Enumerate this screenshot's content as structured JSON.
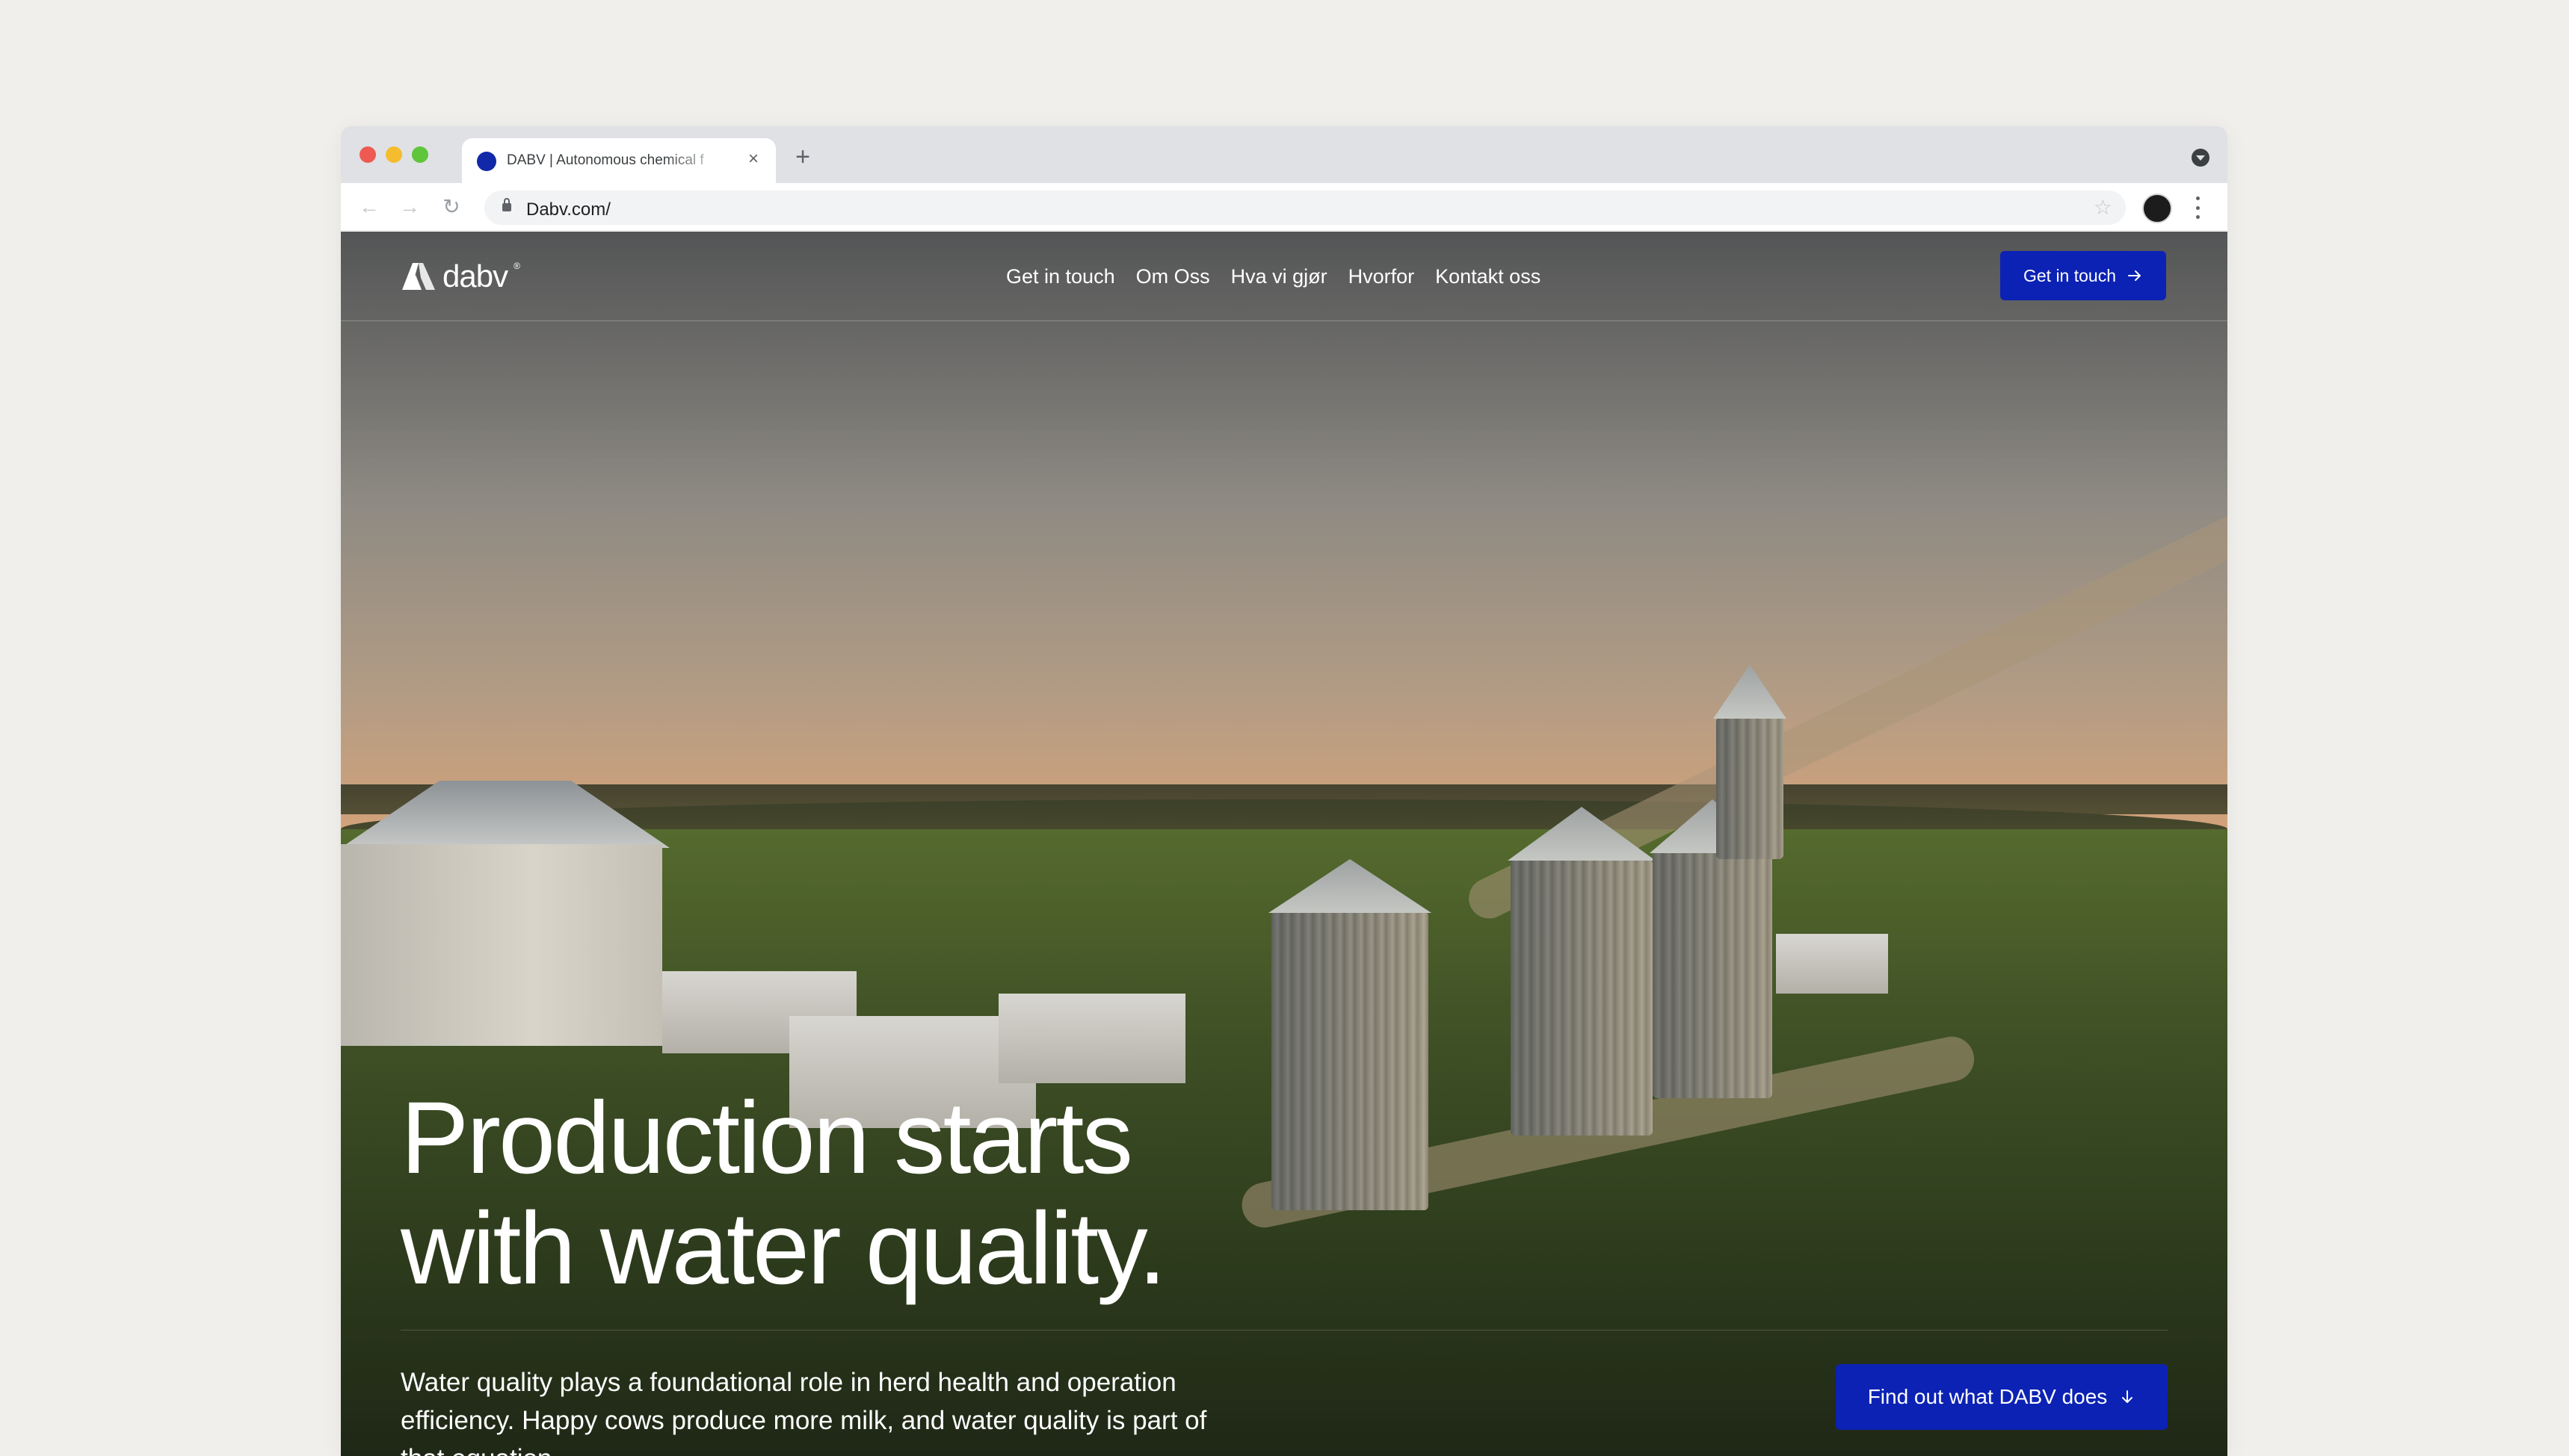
{
  "browser": {
    "tab_title": "DABV | Autonomous chemical f",
    "url": "Dabv.com/"
  },
  "site": {
    "logo_text": "dabv",
    "logo_reg": "®",
    "nav": [
      "Get in touch",
      "Om Oss",
      "Hva vi gjør",
      "Hvorfor",
      "Kontakt oss"
    ],
    "header_cta": "Get in touch",
    "hero": {
      "title_line1": "Production starts",
      "title_line2": "with water quality.",
      "body": "Water quality plays a foundational role in herd health and operation efficiency. Happy cows produce more milk, and water quality is part of that equation.",
      "cta": "Find out what DABV does"
    }
  },
  "colors": {
    "accent": "#0b22b4",
    "page_bg": "#f0efeb",
    "tabbar_bg": "#dfe1e5"
  },
  "icons": [
    "search-icon",
    "lock-icon",
    "star-icon",
    "arrow-right-icon",
    "arrow-down-icon",
    "dabv-logo-icon"
  ]
}
